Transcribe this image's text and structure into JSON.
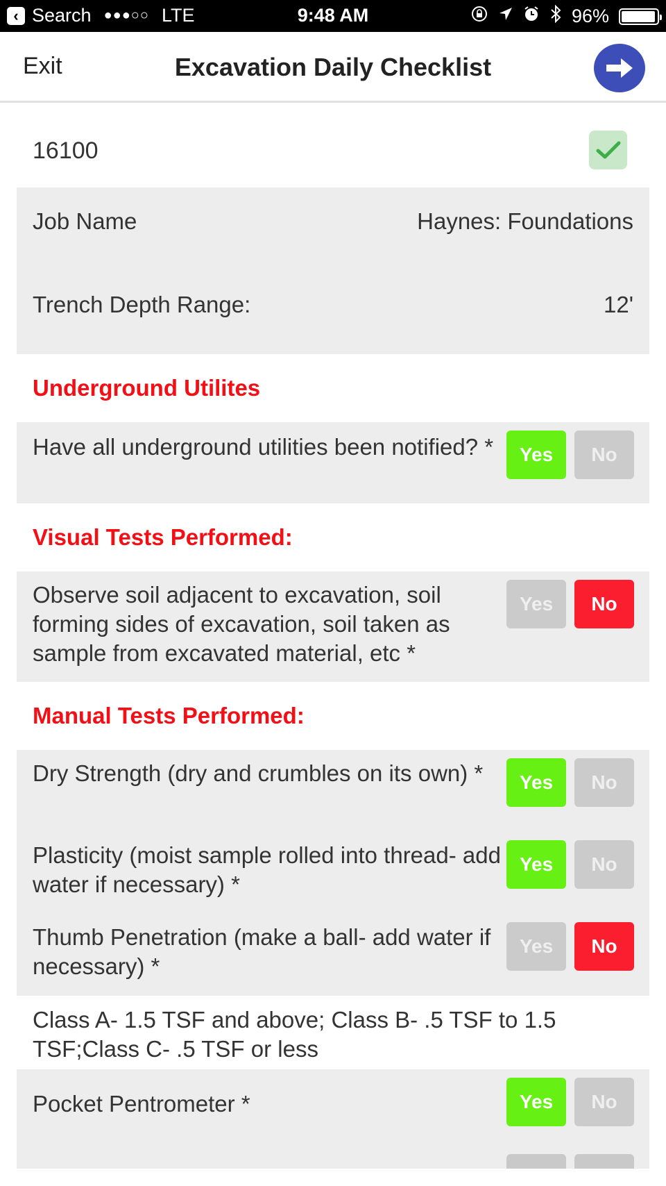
{
  "status_bar": {
    "back_label": "Search",
    "signal": "●●●○○",
    "carrier": "LTE",
    "time": "9:48 AM",
    "battery_percent_label": "96%",
    "battery_level": 0.96,
    "icons": [
      "orientation-lock-icon",
      "location-arrow-icon",
      "alarm-icon",
      "bluetooth-icon"
    ]
  },
  "header": {
    "exit_label": "Exit",
    "title": "Excavation Daily Checklist",
    "next_icon": "arrow-right-icon",
    "accent_color": "#3d4eb8"
  },
  "record": {
    "id": "16100",
    "synced": true
  },
  "info": [
    {
      "label": "Job Name",
      "value": "Haynes: Foundations"
    },
    {
      "label": "Trench Depth Range:",
      "value": "12'"
    }
  ],
  "sections": [
    {
      "title": "Underground Utilites",
      "questions": [
        {
          "text": "Have all underground utilities been notified? *",
          "answer": "Yes"
        }
      ]
    },
    {
      "title": "Visual Tests Performed:",
      "questions": [
        {
          "text": "Observe soil adjacent to excavation, soil forming sides of excavation, soil taken as sample from excavated material, etc *",
          "answer": "No"
        }
      ]
    },
    {
      "title": "Manual Tests Performed:",
      "questions": [
        {
          "text": "Dry Strength (dry and crumbles on its own) *",
          "answer": "Yes"
        },
        {
          "text": "Plasticity (moist sample rolled into thread- add water if necessary) *",
          "answer": "Yes"
        },
        {
          "text": "Thumb Penetration (make a ball- add water if necessary) *",
          "answer": "No"
        }
      ]
    }
  ],
  "note": "Class A- 1.5 TSF and above; Class B- .5 TSF to 1.5 TSF;Class C- .5 TSF or less",
  "pocket": {
    "text": "Pocket Pentrometer *",
    "answer": "Yes"
  },
  "labels": {
    "yes": "Yes",
    "no": "No"
  },
  "colors": {
    "yes_active": "#66f014",
    "no_active": "#fb1e2e",
    "inactive": "#cbcbcb",
    "section_title": "#f20f16"
  }
}
